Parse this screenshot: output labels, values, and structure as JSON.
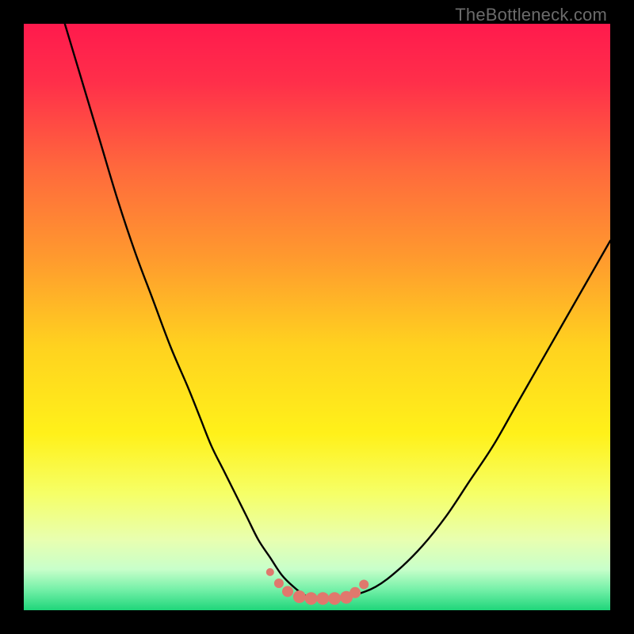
{
  "watermark": "TheBottleneck.com",
  "colors": {
    "frame": "#000000",
    "curve_stroke": "#000000",
    "marker_fill": "#e0786d",
    "watermark": "#6b6b6b",
    "gradient_stops": [
      {
        "offset": 0.0,
        "color": "#ff1a4d"
      },
      {
        "offset": 0.1,
        "color": "#ff2f4a"
      },
      {
        "offset": 0.25,
        "color": "#ff6a3c"
      },
      {
        "offset": 0.4,
        "color": "#ff9a2e"
      },
      {
        "offset": 0.55,
        "color": "#ffd21f"
      },
      {
        "offset": 0.7,
        "color": "#fff11a"
      },
      {
        "offset": 0.8,
        "color": "#f6ff66"
      },
      {
        "offset": 0.88,
        "color": "#e8ffb0"
      },
      {
        "offset": 0.93,
        "color": "#c8ffca"
      },
      {
        "offset": 0.965,
        "color": "#74f0a8"
      },
      {
        "offset": 1.0,
        "color": "#1fd67a"
      }
    ]
  },
  "chart_data": {
    "type": "line",
    "title": "",
    "xlabel": "",
    "ylabel": "",
    "xlim": [
      0,
      100
    ],
    "ylim": [
      0,
      100
    ],
    "grid": false,
    "legend": false,
    "series": [
      {
        "name": "curve",
        "x": [
          7,
          10,
          13,
          16,
          19,
          22,
          25,
          28,
          30,
          32,
          34,
          36,
          38,
          40,
          42,
          44,
          46,
          48,
          50,
          53,
          56,
          60,
          64,
          68,
          72,
          76,
          80,
          84,
          88,
          92,
          96,
          100
        ],
        "y": [
          100,
          90,
          80,
          70,
          61,
          53,
          45,
          38,
          33,
          28,
          24,
          20,
          16,
          12,
          9,
          6,
          4,
          2.5,
          2,
          2,
          2.5,
          4,
          7,
          11,
          16,
          22,
          28,
          35,
          42,
          49,
          56,
          63
        ]
      }
    ],
    "markers": {
      "name": "flat-bottom-markers",
      "x": [
        42,
        43.5,
        45,
        47,
        49,
        51,
        53,
        55,
        56.5,
        58
      ],
      "y": [
        6.5,
        4.6,
        3.2,
        2.3,
        2.0,
        2.0,
        2.0,
        2.2,
        3.0,
        4.4
      ],
      "r": [
        5,
        6,
        7,
        8,
        8,
        8,
        8,
        8,
        7,
        6
      ]
    }
  }
}
